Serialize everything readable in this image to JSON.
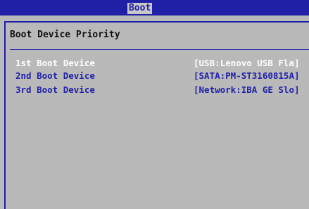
{
  "header": {
    "active_tab": "Boot"
  },
  "panel": {
    "title": "Boot Device Priority"
  },
  "boot_devices": [
    {
      "label": "1st Boot Device",
      "value": "[USB:Lenovo USB Fla]"
    },
    {
      "label": "2nd Boot Device",
      "value": "[SATA:PM-ST3160815A]"
    },
    {
      "label": "3rd Boot Device",
      "value": "[Network:IBA GE Slo]"
    }
  ],
  "colors": {
    "bios_blue": "#1f1fa8",
    "background_gray": "#b9b9b9",
    "selected_text": "#ffffff"
  }
}
